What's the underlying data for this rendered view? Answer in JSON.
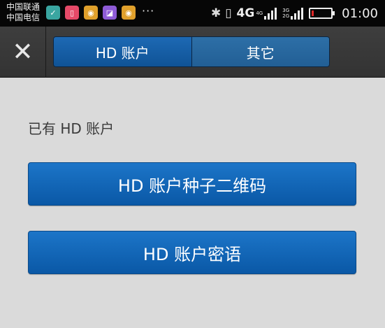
{
  "status_bar": {
    "carrier_1": "中国联通",
    "carrier_2": "中国电信",
    "app_icons": [
      "check-app-icon",
      "pink-app-icon",
      "weibo-icon",
      "gallery-app-icon",
      "weibo-icon"
    ],
    "overflow": "···",
    "network_main": "4G",
    "network_top": "4G",
    "network_sub_top": "3G",
    "network_sub_bottom": "2G",
    "battery_level": 0.1,
    "battery_color": "#e02828",
    "time": "01:00"
  },
  "toolbar": {
    "close_icon": "close-icon",
    "tabs": [
      {
        "label": "HD 账户",
        "active": true
      },
      {
        "label": "其它",
        "active": false
      }
    ]
  },
  "content": {
    "section_title": "已有 HD 账户",
    "buttons": [
      {
        "label": "HD 账户种子二维码"
      },
      {
        "label": "HD 账户密语"
      }
    ],
    "accent_color": "#1266b5"
  }
}
